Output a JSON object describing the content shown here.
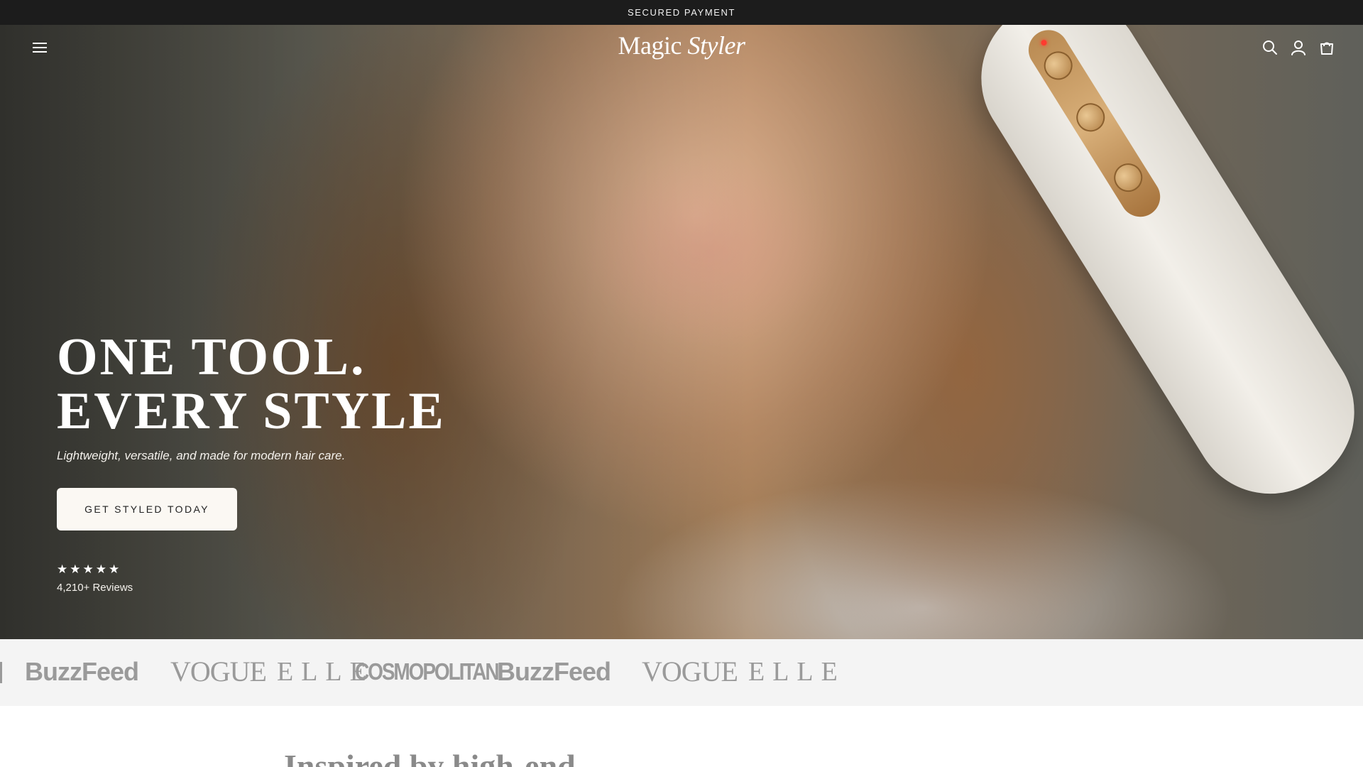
{
  "announcement": {
    "text": "SECURED PAYMENT"
  },
  "header": {
    "logo_part1": "Magic",
    "logo_part2": "Styler",
    "icons": [
      "menu-icon",
      "search-icon",
      "account-icon",
      "cart-icon"
    ]
  },
  "hero": {
    "headline_line1": "ONE TOOL.",
    "headline_line2": "EVERY STYLE",
    "subheadline": "Lightweight, versatile, and made for modern hair care.",
    "cta_label": "GET STYLED TODAY",
    "rating_stars": 5,
    "reviews_text": "4,210+ Reviews"
  },
  "press": {
    "logos": [
      "BuzzFeed",
      "VOGUE",
      "ELLE",
      "COSMOPOLITAN",
      "BuzzFeed",
      "VOGUE",
      "ELLE"
    ]
  },
  "next_section": {
    "heading_partial": "Inspired by high-end"
  },
  "colors": {
    "announcement_bg": "#1c1c1c",
    "cta_bg": "#fbf8f3",
    "press_bg": "#f4f4f4",
    "press_logo": "#9a9a9a"
  }
}
